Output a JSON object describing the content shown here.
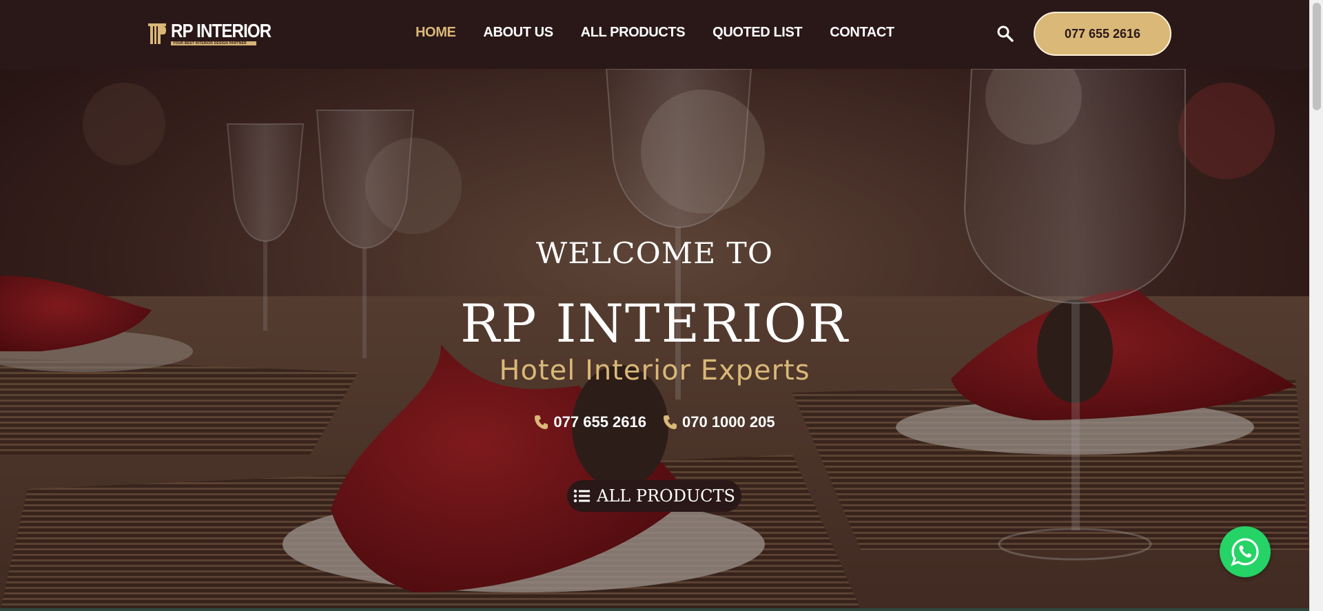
{
  "header": {
    "logo_text": "RP INTERIOR",
    "logo_tagline": "YOUR BEST INTERIOR DESIGN PARTNER",
    "nav": [
      {
        "label": "HOME",
        "active": true
      },
      {
        "label": "ABOUT US",
        "active": false
      },
      {
        "label": "ALL PRODUCTS",
        "active": false
      },
      {
        "label": "QUOTED LIST",
        "active": false
      },
      {
        "label": "CONTACT",
        "active": false
      }
    ],
    "search_icon": "search-icon",
    "phone_button": "077 655 2616"
  },
  "hero": {
    "welcome": "WELCOME TO",
    "title": "RP INTERIOR",
    "subtitle": "Hotel Interior Experts",
    "phones": [
      "077 655 2616",
      "070 1000 205"
    ],
    "cta_label": "ALL PRODUCTS",
    "cta_icon": "list-icon"
  },
  "floating": {
    "whatsapp_icon": "whatsapp-icon"
  },
  "colors": {
    "header_bg": "#2a1718",
    "accent_gold": "#d9b878",
    "whatsapp_green": "#25d366"
  }
}
